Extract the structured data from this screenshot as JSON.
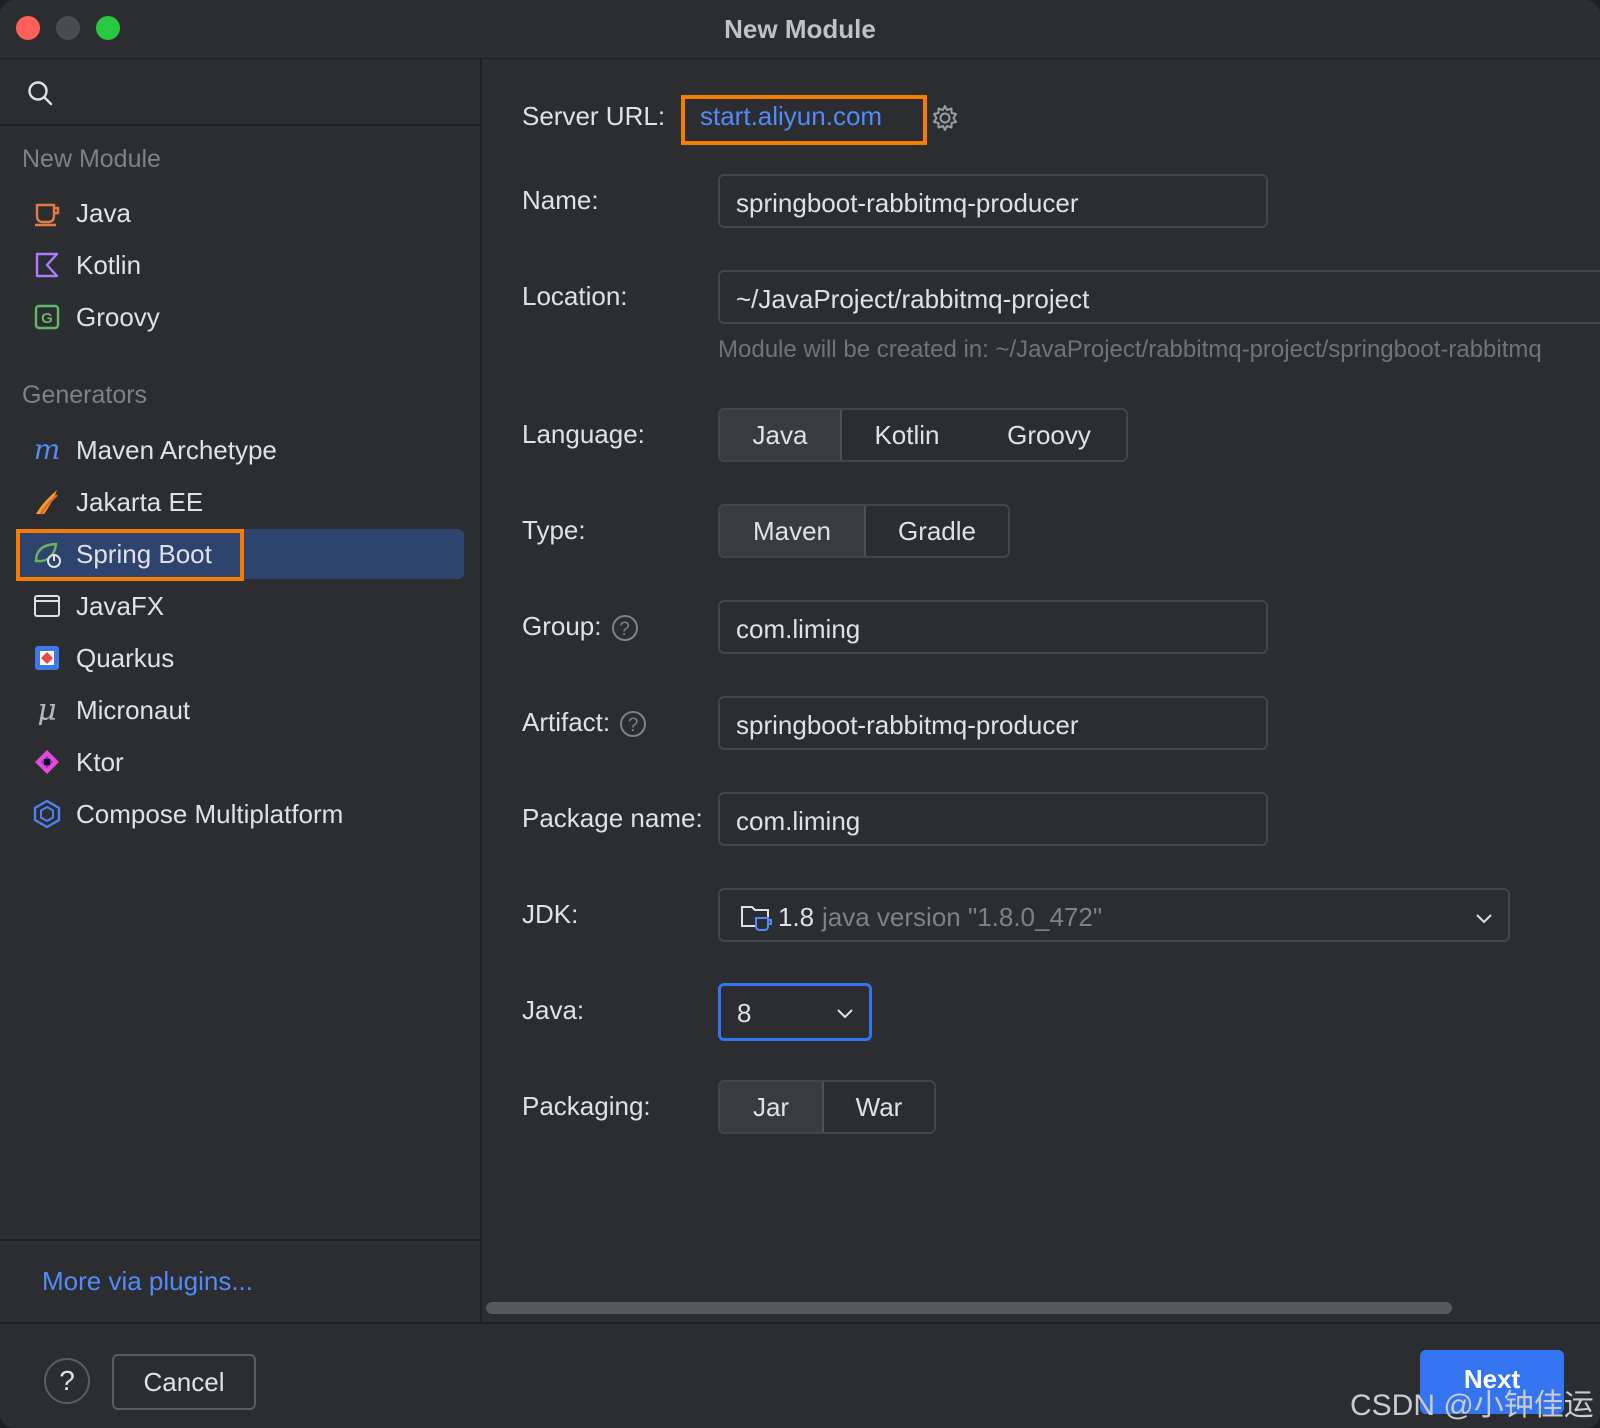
{
  "window": {
    "title": "New Module"
  },
  "sidebar": {
    "section_new": "New Module",
    "section_generators": "Generators",
    "new_items": [
      {
        "label": "Java",
        "icon": "java-cup-icon"
      },
      {
        "label": "Kotlin",
        "icon": "kotlin-icon"
      },
      {
        "label": "Groovy",
        "icon": "groovy-icon"
      }
    ],
    "generator_items": [
      {
        "label": "Maven Archetype",
        "icon": "maven-icon"
      },
      {
        "label": "Jakarta EE",
        "icon": "jakarta-icon"
      },
      {
        "label": "Spring Boot",
        "icon": "spring-boot-icon",
        "selected": true
      },
      {
        "label": "JavaFX",
        "icon": "javafx-icon"
      },
      {
        "label": "Quarkus",
        "icon": "quarkus-icon"
      },
      {
        "label": "Micronaut",
        "icon": "micronaut-icon"
      },
      {
        "label": "Ktor",
        "icon": "ktor-icon"
      },
      {
        "label": "Compose Multiplatform",
        "icon": "compose-icon"
      }
    ],
    "more_link": "More via plugins..."
  },
  "form": {
    "server_url_label": "Server URL:",
    "server_url": "start.aliyun.com",
    "name_label": "Name:",
    "name_value": "springboot-rabbitmq-producer",
    "location_label": "Location:",
    "location_value": "~/JavaProject/rabbitmq-project",
    "location_hint": "Module will be created in: ~/JavaProject/rabbitmq-project/springboot-rabbitmq",
    "language_label": "Language:",
    "language_options": [
      "Java",
      "Kotlin",
      "Groovy"
    ],
    "language_selected": "Java",
    "type_label": "Type:",
    "type_options": [
      "Maven",
      "Gradle"
    ],
    "type_selected": "Maven",
    "group_label": "Group:",
    "group_value": "com.liming",
    "artifact_label": "Artifact:",
    "artifact_value": "springboot-rabbitmq-producer",
    "package_label": "Package name:",
    "package_value": "com.liming",
    "jdk_label": "JDK:",
    "jdk_version": "1.8",
    "jdk_detail": "java version \"1.8.0_472\"",
    "java_label": "Java:",
    "java_value": "8",
    "packaging_label": "Packaging:",
    "packaging_options": [
      "Jar",
      "War"
    ],
    "packaging_selected": "Jar"
  },
  "footer": {
    "help": "?",
    "cancel": "Cancel",
    "next": "Next",
    "watermark": "CSDN @小钟佳运"
  },
  "colors": {
    "accent": "#3574f0",
    "highlight": "#f57c00",
    "selection": "#2e436e",
    "link": "#548af7"
  }
}
